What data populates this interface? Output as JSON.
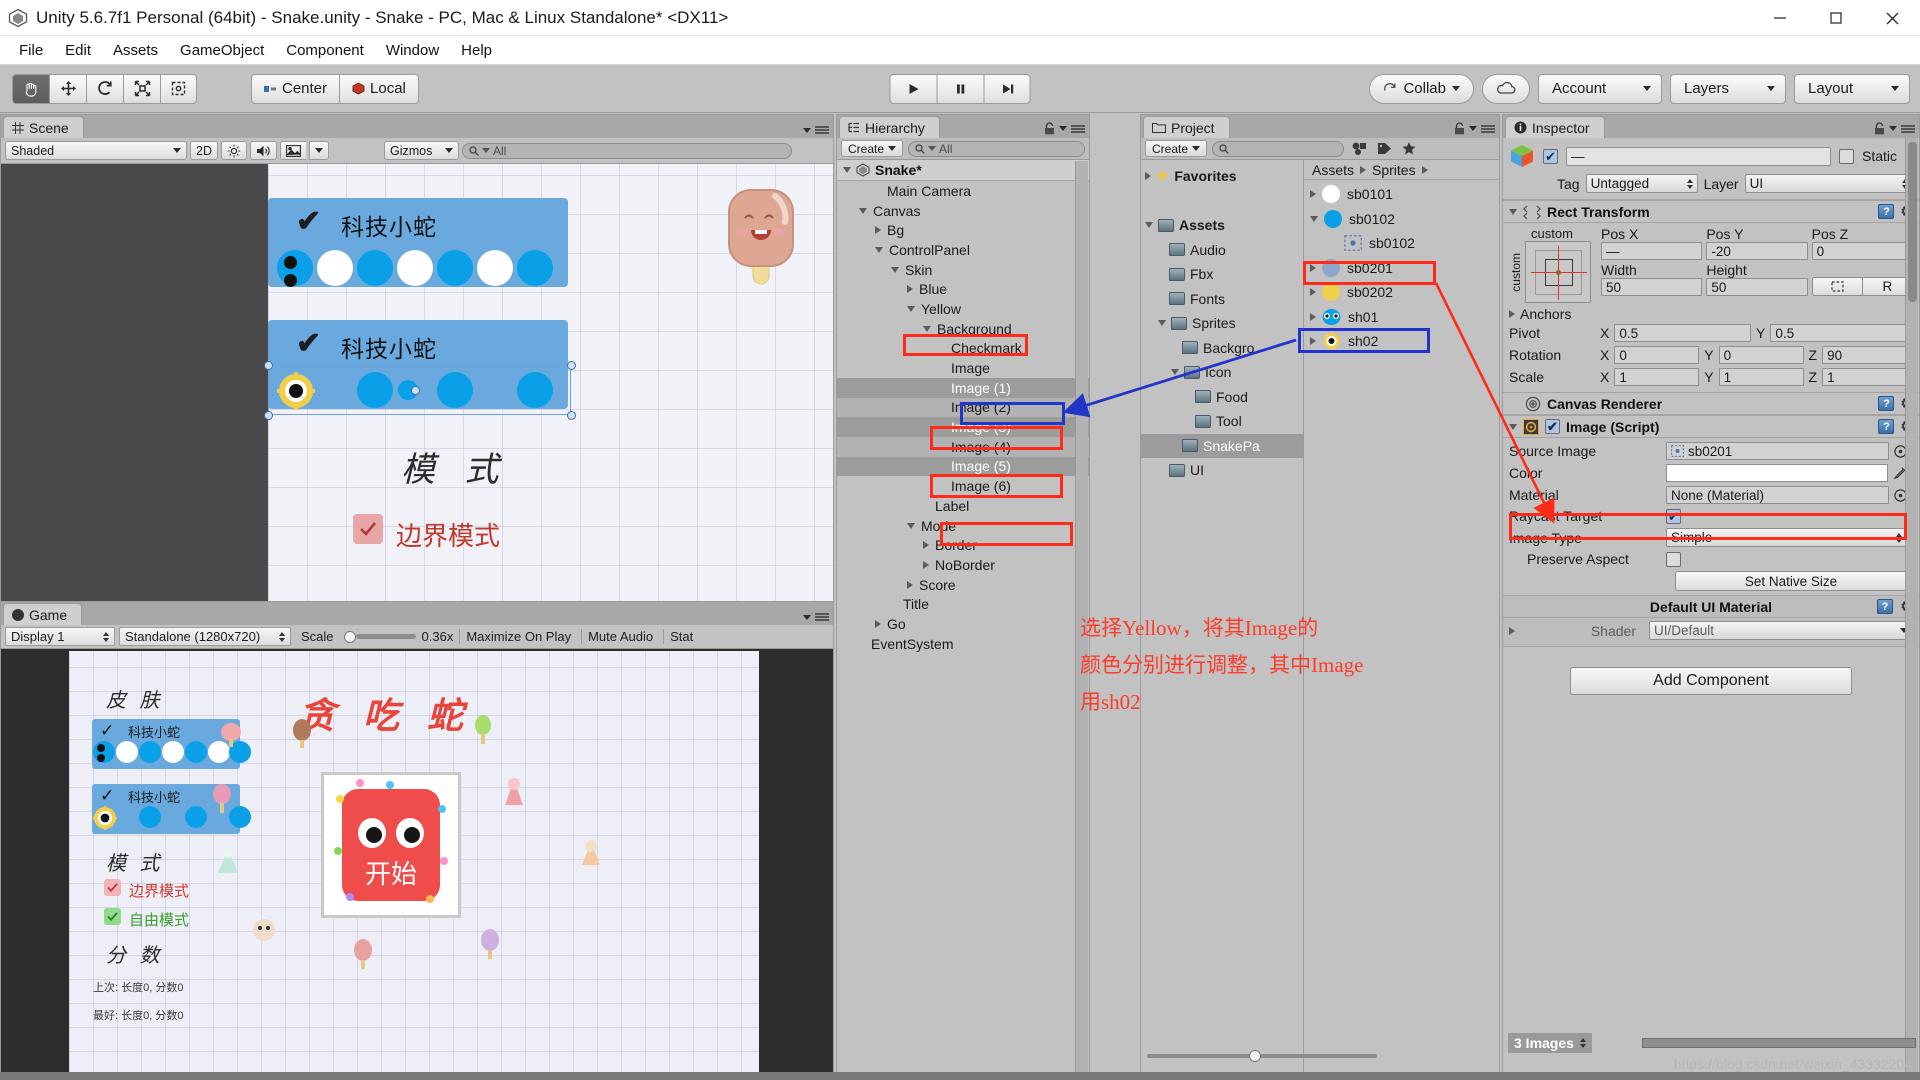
{
  "window": {
    "title": "Unity 5.6.7f1 Personal (64bit) - Snake.unity - Snake - PC, Mac & Linux Standalone* <DX11>",
    "minimize": "minimize-icon",
    "maximize": "maximize-icon",
    "close": "close-icon"
  },
  "menubar": [
    "File",
    "Edit",
    "Assets",
    "GameObject",
    "Component",
    "Window",
    "Help"
  ],
  "toolbar": {
    "tools": [
      "hand-tool",
      "move-tool",
      "rotate-tool",
      "scale-tool",
      "rect-tool"
    ],
    "pivot_mode": "Center",
    "pivot_space": "Local",
    "play": "play-button",
    "pause": "pause-button",
    "step": "step-button",
    "collab": "Collab",
    "cloud": "cloud-button",
    "account": "Account",
    "layers": "Layers",
    "layout": "Layout"
  },
  "scene": {
    "tab": "Scene",
    "shading": "Shaded",
    "mode_2d": "2D",
    "gizmos": "Gizmos",
    "search_placeholder": "All",
    "skin_card_1": {
      "check": "✔",
      "label": "科技小蛇"
    },
    "skin_card_2": {
      "check": "✔",
      "label": "科技小蛇"
    },
    "mode_heading": "模 式",
    "border_mode": "边界模式"
  },
  "game": {
    "tab": "Game",
    "display": "Display 1",
    "resolution": "Standalone (1280x720)",
    "scale_label": "Scale",
    "scale_value": "0.36x",
    "maximize": "Maximize On Play",
    "mute": "Mute Audio",
    "stats": "Stat",
    "skin_heading": "皮 肤",
    "skin_1_label": "科技小蛇",
    "skin_2_label": "科技小蛇",
    "mode_heading": "模 式",
    "mode_border": "边界模式",
    "mode_free": "自由模式",
    "score_heading": "分 数",
    "score_row_1": "上次:  长度0,  分数0",
    "score_row_2": "最好:  长度0,  分数0",
    "game_title": "贪 吃 蛇",
    "start_button": "开始"
  },
  "hierarchy": {
    "tab": "Hierarchy",
    "create": "Create",
    "search_placeholder": "All",
    "scene_name": "Snake*",
    "items": [
      {
        "label": "Main Camera",
        "depth": 2,
        "toggle": "none",
        "selected": false,
        "alt": false
      },
      {
        "label": "Canvas",
        "depth": 1,
        "toggle": "down",
        "selected": false,
        "alt": false
      },
      {
        "label": "Bg",
        "depth": 2,
        "toggle": "right",
        "selected": false,
        "alt": false
      },
      {
        "label": "ControlPanel",
        "depth": 2,
        "toggle": "down",
        "selected": false,
        "alt": false
      },
      {
        "label": "Skin",
        "depth": 3,
        "toggle": "down",
        "selected": false,
        "alt": false
      },
      {
        "label": "Blue",
        "depth": 4,
        "toggle": "right",
        "selected": false,
        "alt": false
      },
      {
        "label": "Yellow",
        "depth": 4,
        "toggle": "down",
        "selected": false,
        "alt": false
      },
      {
        "label": "Background",
        "depth": 5,
        "toggle": "down",
        "selected": false,
        "alt": false
      },
      {
        "label": "Checkmark",
        "depth": 6,
        "toggle": "none",
        "selected": false,
        "alt": false
      },
      {
        "label": "Image",
        "depth": 6,
        "toggle": "none",
        "selected": false,
        "alt": false
      },
      {
        "label": "Image (1)",
        "depth": 6,
        "toggle": "none",
        "selected": true,
        "alt": false
      },
      {
        "label": "Image (2)",
        "depth": 6,
        "toggle": "none",
        "selected": false,
        "alt": true
      },
      {
        "label": "Image (3)",
        "depth": 6,
        "toggle": "none",
        "selected": true,
        "alt": false
      },
      {
        "label": "Image (4)",
        "depth": 6,
        "toggle": "none",
        "selected": false,
        "alt": true
      },
      {
        "label": "Image (5)",
        "depth": 6,
        "toggle": "none",
        "selected": true,
        "alt": false
      },
      {
        "label": "Image (6)",
        "depth": 6,
        "toggle": "none",
        "selected": false,
        "alt": false
      },
      {
        "label": "Label",
        "depth": 5,
        "toggle": "none",
        "selected": false,
        "alt": false
      },
      {
        "label": "Mode",
        "depth": 4,
        "toggle": "down",
        "selected": false,
        "alt": false
      },
      {
        "label": "Border",
        "depth": 5,
        "toggle": "right",
        "selected": false,
        "alt": false
      },
      {
        "label": "NoBorder",
        "depth": 5,
        "toggle": "right",
        "selected": false,
        "alt": false
      },
      {
        "label": "Score",
        "depth": 4,
        "toggle": "right",
        "selected": false,
        "alt": false
      },
      {
        "label": "Title",
        "depth": 3,
        "toggle": "none",
        "selected": false,
        "alt": false
      },
      {
        "label": "Go",
        "depth": 2,
        "toggle": "right",
        "selected": false,
        "alt": false
      },
      {
        "label": "EventSystem",
        "depth": 1,
        "toggle": "none",
        "selected": false,
        "alt": false
      }
    ]
  },
  "project": {
    "tab": "Project",
    "create": "Create",
    "search_placeholder": "",
    "tree": [
      {
        "label": "Favorites",
        "depth": 0,
        "toggle": "right",
        "icon": "star",
        "bold": true,
        "selected": false
      },
      {
        "label": "",
        "depth": 0,
        "toggle": "none",
        "icon": "none",
        "bold": false,
        "selected": false
      },
      {
        "label": "Assets",
        "depth": 0,
        "toggle": "down",
        "icon": "folder",
        "bold": true,
        "selected": false
      },
      {
        "label": "Audio",
        "depth": 1,
        "toggle": "none",
        "icon": "folder",
        "bold": false,
        "selected": false
      },
      {
        "label": "Fbx",
        "depth": 1,
        "toggle": "none",
        "icon": "folder",
        "bold": false,
        "selected": false
      },
      {
        "label": "Fonts",
        "depth": 1,
        "toggle": "none",
        "icon": "folder",
        "bold": false,
        "selected": false
      },
      {
        "label": "Sprites",
        "depth": 1,
        "toggle": "down",
        "icon": "folder",
        "bold": false,
        "selected": false
      },
      {
        "label": "Backgro",
        "depth": 2,
        "toggle": "none",
        "icon": "folder",
        "bold": false,
        "selected": false
      },
      {
        "label": "Icon",
        "depth": 2,
        "toggle": "down",
        "icon": "folder",
        "bold": false,
        "selected": false
      },
      {
        "label": "Food",
        "depth": 3,
        "toggle": "none",
        "icon": "folder",
        "bold": false,
        "selected": false
      },
      {
        "label": "Tool",
        "depth": 3,
        "toggle": "none",
        "icon": "folder",
        "bold": false,
        "selected": false
      },
      {
        "label": "SnakePa",
        "depth": 2,
        "toggle": "none",
        "icon": "folder",
        "bold": false,
        "selected": true
      },
      {
        "label": "UI",
        "depth": 1,
        "toggle": "none",
        "icon": "folder",
        "bold": false,
        "selected": false
      }
    ],
    "breadcrumb": [
      "Assets",
      "Sprites"
    ],
    "assets": [
      {
        "label": "sb0101",
        "toggle": "right",
        "icon": "sphere",
        "color": "#ffffff",
        "depth": 0
      },
      {
        "label": "sb0102",
        "toggle": "down",
        "icon": "sphere",
        "color": "#0aa0e8",
        "depth": 0
      },
      {
        "label": "sb0102",
        "toggle": "none",
        "icon": "sprite",
        "color": "#7fa8cc",
        "depth": 1
      },
      {
        "label": "sb0201",
        "toggle": "right",
        "icon": "sphere",
        "color": "#8fa6cc",
        "depth": 0
      },
      {
        "label": "sb0202",
        "toggle": "right",
        "icon": "sphere",
        "color": "#f2cf4a",
        "depth": 0
      },
      {
        "label": "sh01",
        "toggle": "right",
        "icon": "head-blue",
        "color": "#0aa0e8",
        "depth": 0
      },
      {
        "label": "sh02",
        "toggle": "right",
        "icon": "head-yellow",
        "color": "#f2cf4a",
        "depth": 0
      }
    ]
  },
  "inspector": {
    "tab": "Inspector",
    "object_name": "—",
    "static_label": "Static",
    "tag_label": "Tag",
    "tag_value": "Untagged",
    "layer_label": "Layer",
    "layer_value": "UI",
    "rect_transform": {
      "title": "Rect Transform",
      "anchor_preset": "custom",
      "anchor_side": "custom",
      "pos_x_label": "Pos X",
      "pos_x": "—",
      "pos_y_label": "Pos Y",
      "pos_y": "-20",
      "pos_z_label": "Pos Z",
      "pos_z": "0",
      "width_label": "Width",
      "width": "50",
      "height_label": "Height",
      "height": "50",
      "blueprint_btn": "blueprint-icon",
      "raw_btn": "R",
      "anchors_label": "Anchors",
      "pivot_label": "Pivot",
      "pivot_x": "0.5",
      "pivot_y": "0.5",
      "rotation_label": "Rotation",
      "rot_x": "0",
      "rot_y": "0",
      "rot_z": "90",
      "scale_label": "Scale",
      "scale_x": "1",
      "scale_y": "1",
      "scale_z": "1"
    },
    "canvas_renderer": {
      "title": "Canvas Renderer"
    },
    "image_script": {
      "title": "Image (Script)",
      "source_image_label": "Source Image",
      "source_image_value": "sb0201",
      "color_label": "Color",
      "color_value": "#ffffff",
      "material_label": "Material",
      "material_value": "None (Material)",
      "raycast_label": "Raycast Target",
      "image_type_label": "Image Type",
      "image_type_value": "Simple",
      "preserve_aspect_label": "Preserve Aspect",
      "set_native_size": "Set Native Size"
    },
    "material": {
      "title": "Default UI Material",
      "shader_label": "Shader",
      "shader_value": "UI/Default"
    },
    "add_component": "Add Component"
  },
  "status": {
    "image_count": "3 Images",
    "watermark": "https://blog.csdn.net/weixin_43332204"
  },
  "annotation": {
    "text_line_1": "选择Yellow，将其Image的",
    "text_line_2": "颜色分别进行调整，其中Image",
    "text_line_3": "用sh02",
    "red": "#ff2a18",
    "blue": "#2335c8"
  }
}
